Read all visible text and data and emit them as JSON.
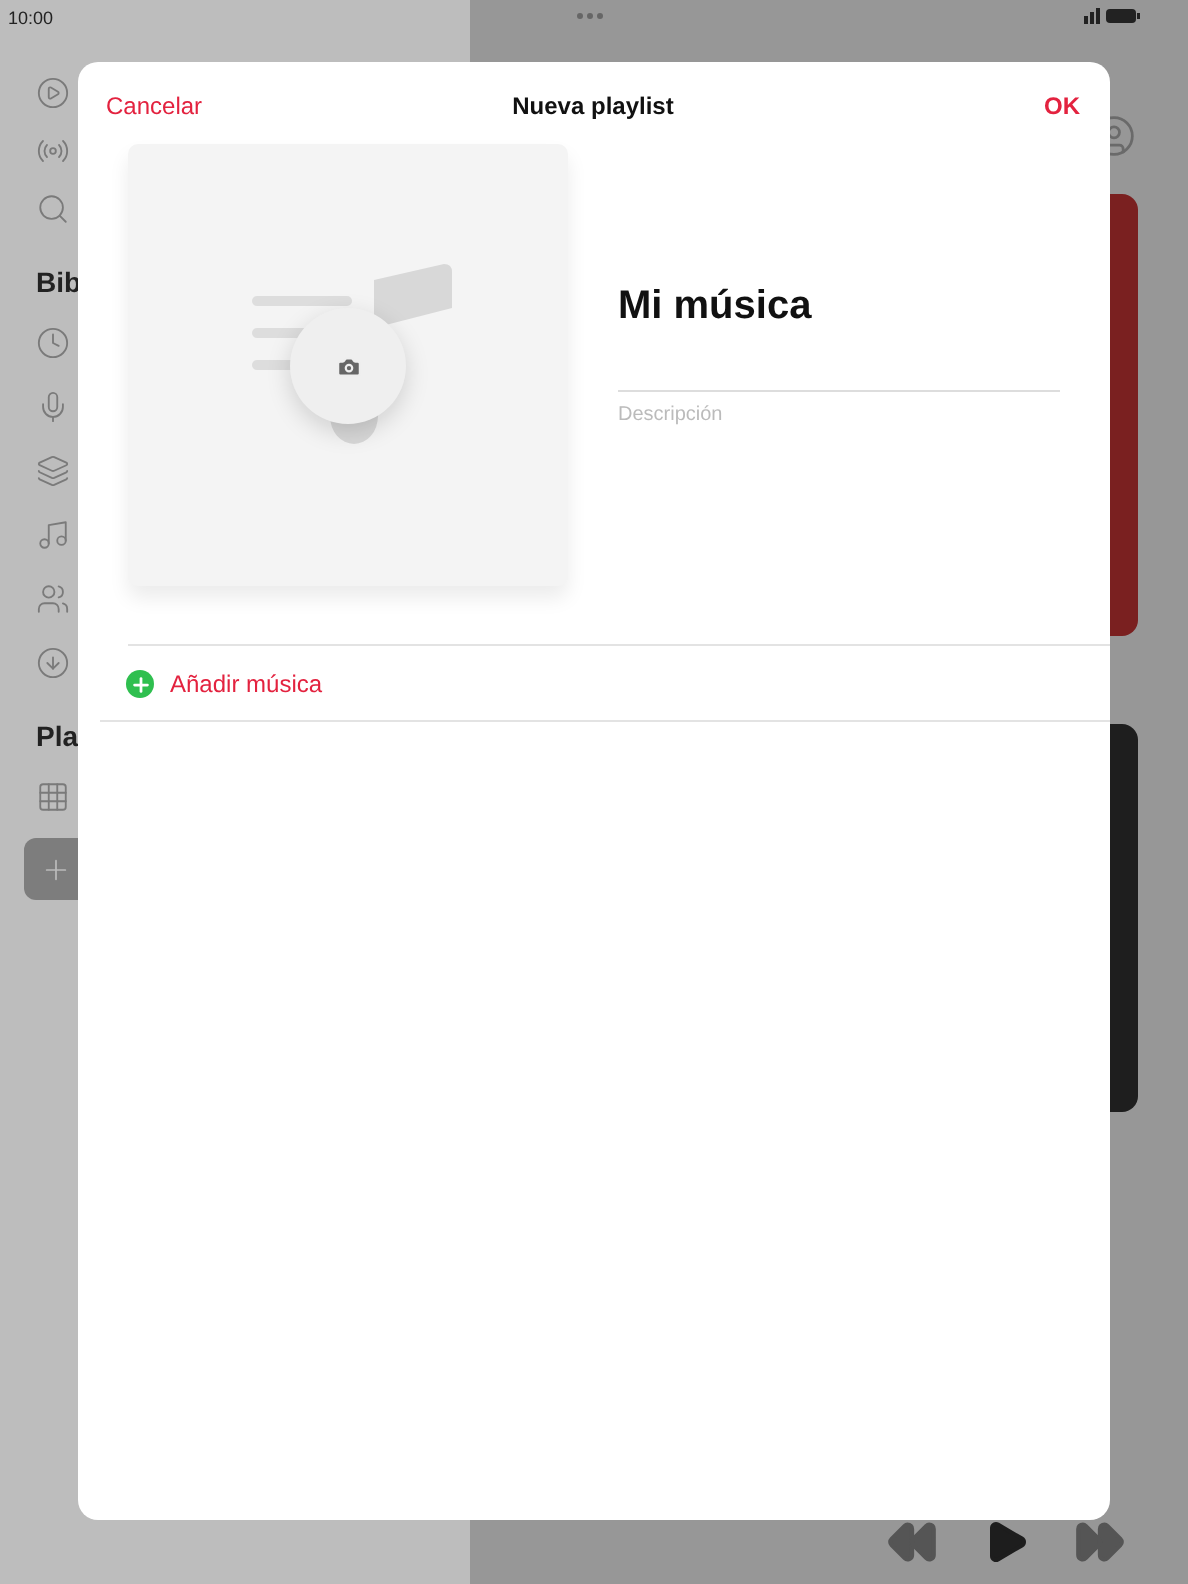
{
  "status_bar": {
    "time": "10:00"
  },
  "sidebar": {
    "sections": [
      {
        "title": "Bib"
      },
      {
        "title": "Pla"
      }
    ]
  },
  "modal": {
    "cancel": "Cancelar",
    "title": "Nueva playlist",
    "ok": "OK",
    "name": "Mi música",
    "description": {
      "placeholder": "Descripción"
    },
    "add_row": {
      "label": "Añadir música"
    }
  }
}
